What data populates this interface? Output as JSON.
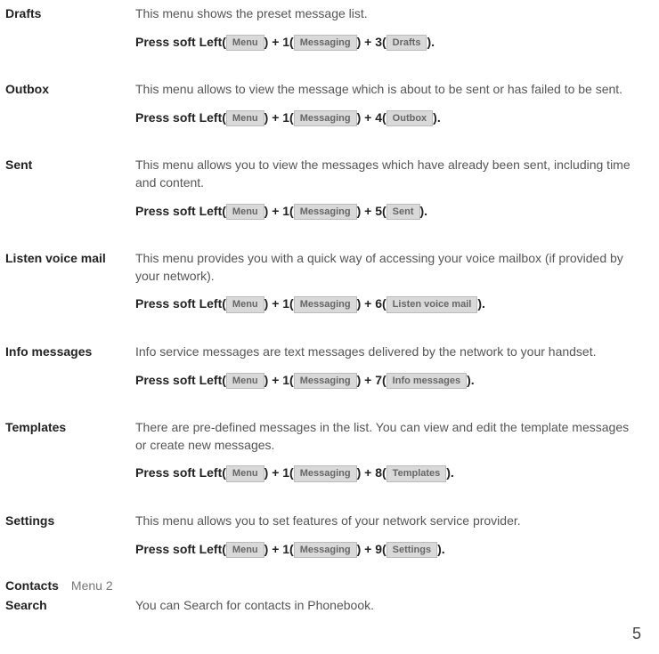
{
  "entries": [
    {
      "term": "Drafts",
      "desc": "This menu shows the preset message list.",
      "seq_label": "Press soft Left(",
      "k1": "Menu",
      "s1": ") + 1(",
      "k2": "Messaging",
      "s2": ") + 3(",
      "k3": "Drafts",
      "s3": ")."
    },
    {
      "term": "Outbox",
      "desc": "This menu allows to view the message which is about to be sent or has failed to be sent.",
      "seq_label": "Press soft Left(",
      "k1": "Menu",
      "s1": ") + 1(",
      "k2": "Messaging",
      "s2": ") + 4(",
      "k3": "Outbox",
      "s3": ")."
    },
    {
      "term": "Sent",
      "desc": "This menu allows you to view the messages which have already been sent, including time and content.",
      "seq_label": "Press soft Left(",
      "k1": "Menu",
      "s1": ") + 1(",
      "k2": "Messaging",
      "s2": ") + 5(",
      "k3": "Sent",
      "s3": ")."
    },
    {
      "term": "Listen voice mail",
      "desc": "This menu provides you with a quick way of accessing your voice mailbox (if provided by your network).",
      "seq_label": "Press soft Left(",
      "k1": "Menu",
      "s1": ") + 1(",
      "k2": "Messaging",
      "s2": ") + 6(",
      "k3": "Listen voice mail",
      "s3": ")."
    },
    {
      "term": "Info messages",
      "desc": "Info service messages are text messages delivered by the network to your handset.",
      "seq_label": "Press soft Left(",
      "k1": "Menu",
      "s1": ") + 1(",
      "k2": "Messaging",
      "s2": ") + 7(",
      "k3": "Info messages",
      "s3": ")."
    },
    {
      "term": "Templates",
      "desc": "There are pre-defined messages in the list. You can view and edit the template messages or create new messages.",
      "seq_label": "Press soft Left(",
      "k1": "Menu",
      "s1": ") + 1(",
      "k2": "Messaging",
      "s2": ") + 8(",
      "k3": "Templates",
      "s3": ")."
    },
    {
      "term": "Settings",
      "desc": "This menu allows you to set features of your network service provider.",
      "seq_label": "Press soft Left(",
      "k1": "Menu",
      "s1": ") + 1(",
      "k2": "Messaging",
      "s2": ") + 9(",
      "k3": "Settings",
      "s3": ")."
    }
  ],
  "section": {
    "title": "Contacts",
    "sub": "Menu 2"
  },
  "search": {
    "term": "Search",
    "desc": "You can Search for contacts in Phonebook."
  },
  "page_number": "5"
}
